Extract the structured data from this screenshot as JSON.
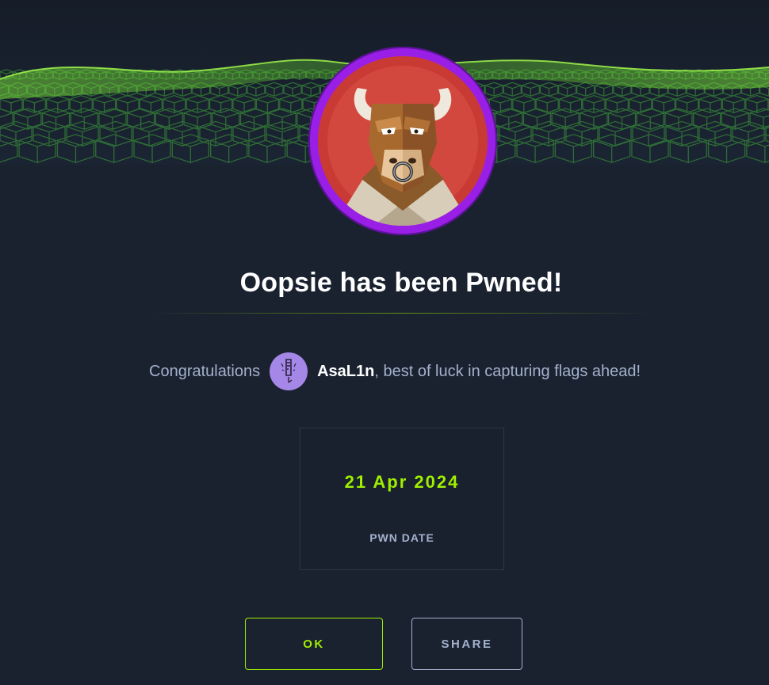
{
  "machine": {
    "name": "Oopsie",
    "avatar_icon": "bull-mascot-icon"
  },
  "title": "Oopsie has been Pwned!",
  "congrats": {
    "prefix": "Congratulations",
    "username": "AsaL1n",
    "suffix": ", best of luck in capturing flags ahead!",
    "user_avatar_icon": "user-avatar-icon"
  },
  "pwn": {
    "date": "21 Apr 2024",
    "label": "PWN DATE"
  },
  "buttons": {
    "ok_label": "OK",
    "share_label": "SHARE"
  },
  "colors": {
    "accent": "#9fef00",
    "machine_ring": "#9a1fe6",
    "background": "#1a2230",
    "text_muted": "#a4b1cd"
  }
}
